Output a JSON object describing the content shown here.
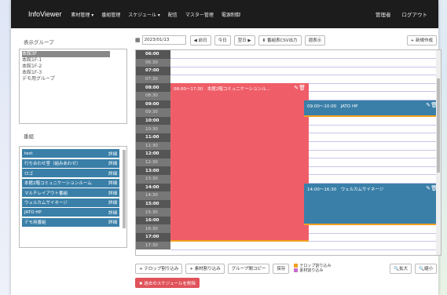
{
  "nav": {
    "brand": "InfoViewer",
    "items": [
      "素材管理 ▾",
      "番組管理",
      "スケジュール ▾",
      "配信",
      "マスター管理",
      "電源制御"
    ],
    "right": [
      "管理者",
      "ログアウト"
    ]
  },
  "sidebar": {
    "group_title": "表示グループ",
    "groups": [
      "本館3F",
      "本館1F-1",
      "本館1F-2",
      "本館1F-3",
      "デモ用グループ"
    ],
    "program_title": "番組",
    "programs": [
      "test",
      "行ち合わせ室（組みあわせ）",
      "ロゴ",
      "本館2階コミュニケーションルーム",
      "マルチレイアウト番組",
      "ウェルカムサイネージ",
      "JATO HP",
      "デモ用番組"
    ],
    "detail_label": "詳細"
  },
  "toolbar": {
    "date": "2023/01/13",
    "prev": "◀ 前日",
    "today": "今日",
    "next": "翌日 ▶",
    "csv": "⬇ 番組表CSV出力",
    "week": "週表示",
    "new": "+ 新規作成"
  },
  "times": [
    "06:00",
    "06:30",
    "07:00",
    "07:30",
    "08:00",
    "08:30",
    "09:00",
    "09:30",
    "10:00",
    "10:30",
    "11:00",
    "11:30",
    "12:00",
    "12:30",
    "13:00",
    "13:30",
    "14:00",
    "14:30",
    "15:00",
    "15:30",
    "16:00",
    "16:30",
    "17:00",
    "17:30"
  ],
  "events": [
    {
      "label": "08:00〜17:30　本館2階コミュニケーションル…",
      "color": "#ef5e68"
    },
    {
      "label": "09:00〜10:00　JATO HP",
      "color": "#3a7fa8"
    },
    {
      "label": "14:00〜16:30　ウェルカムサイネージ",
      "color": "#3a7fa8"
    }
  ],
  "bottom": {
    "telop": "+ テロップ割り込み",
    "material": "+ 素材割り込み",
    "copy": "グループ間コピー",
    "save": "保存",
    "legend": [
      "テロップ割り込み",
      "素材割り込み"
    ],
    "zoom_in": "🔍拡大",
    "zoom_out": "🔍縮小",
    "delete": "✖ 過去のスケジュールを削除"
  },
  "colors": {
    "legend_telop": "#f0a020",
    "legend_material": "#c86fc8"
  }
}
